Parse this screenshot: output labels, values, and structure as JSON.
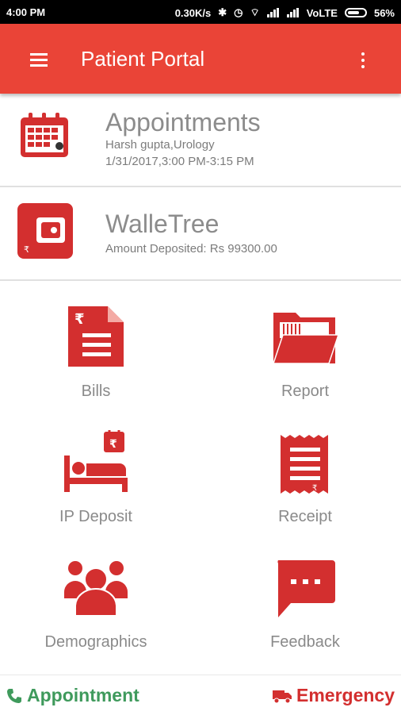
{
  "status_bar": {
    "time": "4:00 PM",
    "net_speed": "0.30K/s",
    "network": "VoLTE",
    "battery": "56%"
  },
  "header": {
    "title": "Patient Portal"
  },
  "appointments_card": {
    "title": "Appointments",
    "doctor": "Harsh gupta,Urology",
    "datetime": "1/31/2017,3:00 PM-3:15 PM",
    "icon": "calendar-icon"
  },
  "wallet_card": {
    "title": "WalleTree",
    "amount": "Amount Deposited: Rs 99300.00",
    "icon": "wallet-icon"
  },
  "grid": {
    "bills": "Bills",
    "report": "Report",
    "ip_deposit": "IP Deposit",
    "receipt": "Receipt",
    "demographics": "Demographics",
    "feedback": "Feedback"
  },
  "bottom_bar": {
    "appointment": "Appointment",
    "emergency": "Emergency"
  },
  "colors": {
    "accent": "#ea4437",
    "icon_red": "#d32f2f",
    "green": "#3f9a5c"
  }
}
